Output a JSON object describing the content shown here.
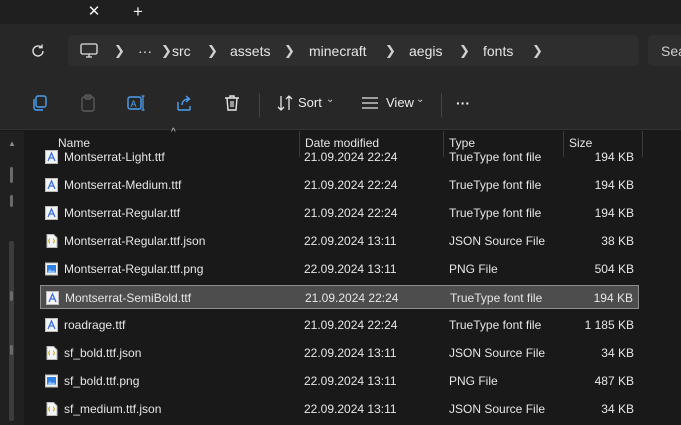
{
  "tabs": {
    "close_glyph": "✕",
    "new_glyph": "+"
  },
  "breadcrumb": [
    "src",
    "assets",
    "minecraft",
    "aegis",
    "fonts"
  ],
  "breadcrumb_more": "···",
  "search": {
    "placeholder": "Sea"
  },
  "commandbar": {
    "sort_label": "Sort",
    "view_label": "View",
    "more_label": "···"
  },
  "columns": {
    "name": "Name",
    "date": "Date modified",
    "type": "Type",
    "size": "Size"
  },
  "files": [
    {
      "name": "Montserrat-Light.ttf",
      "date": "21.09.2024 22:24",
      "type": "TrueType font file",
      "size": "194 KB",
      "icon": "font-file-icon"
    },
    {
      "name": "Montserrat-Medium.ttf",
      "date": "21.09.2024 22:24",
      "type": "TrueType font file",
      "size": "194 KB",
      "icon": "font-file-icon"
    },
    {
      "name": "Montserrat-Regular.ttf",
      "date": "21.09.2024 22:24",
      "type": "TrueType font file",
      "size": "194 KB",
      "icon": "font-file-icon"
    },
    {
      "name": "Montserrat-Regular.ttf.json",
      "date": "22.09.2024 13:11",
      "type": "JSON Source File",
      "size": "38 KB",
      "icon": "json-file-icon"
    },
    {
      "name": "Montserrat-Regular.ttf.png",
      "date": "22.09.2024 13:11",
      "type": "PNG File",
      "size": "504 KB",
      "icon": "image-file-icon"
    },
    {
      "name": "Montserrat-SemiBold.ttf",
      "date": "21.09.2024 22:24",
      "type": "TrueType font file",
      "size": "194 KB",
      "icon": "font-file-icon",
      "selected": true
    },
    {
      "name": "roadrage.ttf",
      "date": "21.09.2024 22:24",
      "type": "TrueType font file",
      "size": "1 185 KB",
      "icon": "font-file-icon"
    },
    {
      "name": "sf_bold.ttf.json",
      "date": "22.09.2024 13:11",
      "type": "JSON Source File",
      "size": "34 KB",
      "icon": "json-file-icon"
    },
    {
      "name": "sf_bold.ttf.png",
      "date": "22.09.2024 13:11",
      "type": "PNG File",
      "size": "487 KB",
      "icon": "image-file-icon"
    },
    {
      "name": "sf_medium.ttf.json",
      "date": "22.09.2024 13:11",
      "type": "JSON Source File",
      "size": "34 KB",
      "icon": "json-file-icon"
    }
  ],
  "colors": {
    "background": "#191919",
    "selection": "#4d4d4d",
    "font_icon_blue": "#3a6fd8",
    "png_icon_blue": "#2f7fe0"
  }
}
